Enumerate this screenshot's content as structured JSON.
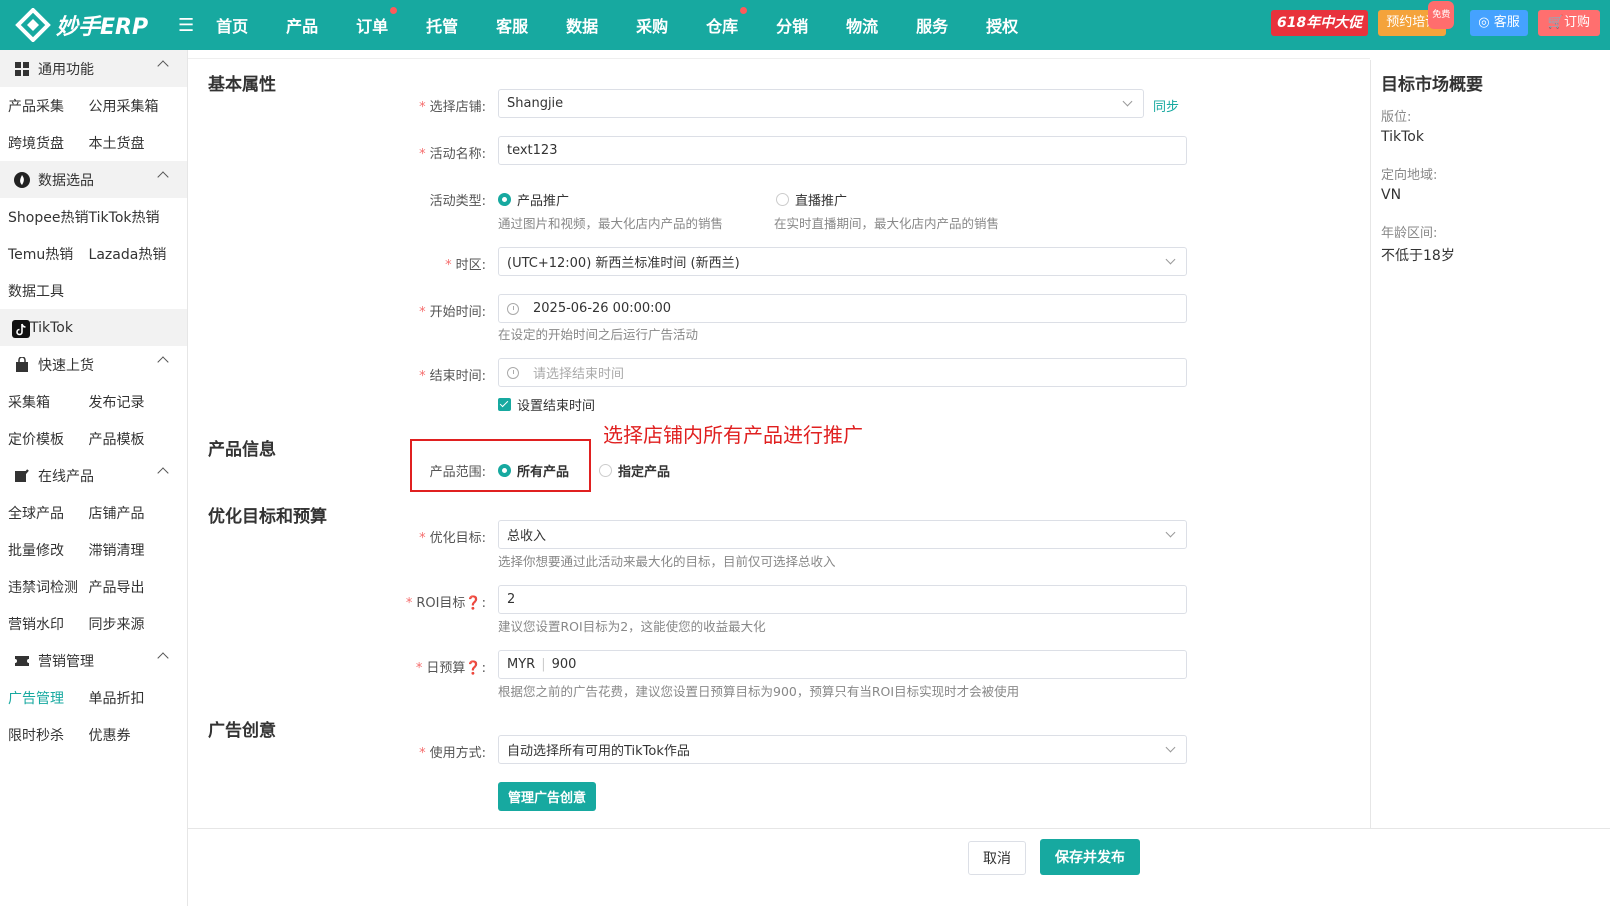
{
  "header": {
    "logo_text": "妙手ERP",
    "nav": [
      "首页",
      "产品",
      "订单",
      "托管",
      "客服",
      "数据",
      "采购",
      "仓库",
      "分销",
      "物流",
      "服务",
      "授权"
    ],
    "promo": "618年中大促",
    "training": "预约培训",
    "free_badge": "免费",
    "customer_service": "客服",
    "order": "订购"
  },
  "sidebar": {
    "g_common": "通用功能",
    "product_collect": "产品采集",
    "public_box": "公用采集箱",
    "cross_border": "跨境货盘",
    "local_goods": "本土货盘",
    "g_data": "数据选品",
    "shopee_hot": "Shopee热销",
    "tiktok_hot": "TikTok热销",
    "temu_hot": "Temu热销",
    "lazada_hot": "Lazada热销",
    "data_tools": "数据工具",
    "g_tiktok": "TikTok",
    "g_quick": "快速上货",
    "collect_box": "采集箱",
    "publish_log": "发布记录",
    "pricing_tpl": "定价模板",
    "product_tpl": "产品模板",
    "g_online": "在线产品",
    "global_products": "全球产品",
    "store_products": "店铺产品",
    "bulk_edit": "批量修改",
    "slow_clear": "滞销清理",
    "banned_words": "违禁词检测",
    "product_export": "产品导出",
    "watermark": "营销水印",
    "sync_source": "同步来源",
    "g_marketing": "营销管理",
    "ad_manage": "广告管理",
    "single_discount": "单品折扣",
    "flash_sale": "限时秒杀",
    "coupon": "优惠券"
  },
  "form": {
    "basic_title": "基本属性",
    "store_label": "选择店铺:",
    "store_value": "Shangjie",
    "sync": "同步",
    "name_label": "活动名称:",
    "name_value": "text123",
    "type_label": "活动类型:",
    "type_product": "产品推广",
    "type_product_hint": "通过图片和视频，最大化店内产品的销售",
    "type_live": "直播推广",
    "type_live_hint": "在实时直播期间，最大化店内产品的销售",
    "tz_label": "时区:",
    "tz_value": "(UTC+12:00) 新西兰标准时间 (新西兰)",
    "start_label": "开始时间:",
    "start_value": "2025-06-26 00:00:00",
    "start_hint": "在设定的开始时间之后运行广告活动",
    "end_label": "结束时间:",
    "end_placeholder": "请选择结束时间",
    "end_checkbox": "设置结束时间",
    "product_title": "产品信息",
    "scope_label": "产品范围:",
    "scope_all": "所有产品",
    "scope_specific": "指定产品",
    "annotation": "选择店铺内所有产品进行推广",
    "optimize_title": "优化目标和预算",
    "goal_label": "优化目标:",
    "goal_value": "总收入",
    "goal_hint": "选择你想要通过此活动来最大化的目标，目前仅可选择总收入",
    "roi_label": "ROI目标",
    "roi_value": "2",
    "roi_hint": "建议您设置ROI目标为2，这能使您的收益最大化",
    "budget_label": "日预算",
    "budget_currency": "MYR",
    "budget_value": "900",
    "budget_hint": "根据您之前的广告花费，建议您设置日预算目标为900，预算只有当ROI目标实现时才会被使用",
    "creative_title": "广告创意",
    "usage_label": "使用方式:",
    "usage_value": "自动选择所有可用的TikTok作品",
    "manage_creative": "管理广告创意"
  },
  "right_panel": {
    "title": "目标市场概要",
    "layout_label": "版位:",
    "layout_value": "TikTok",
    "region_label": "定向地域:",
    "region_value": "VN",
    "age_label": "年龄区间:",
    "age_value": "不低于18岁"
  },
  "footer": {
    "cancel": "取消",
    "save": "保存并发布"
  },
  "colors": {
    "primary": "#17a9a0",
    "annotation": "#e02020"
  }
}
